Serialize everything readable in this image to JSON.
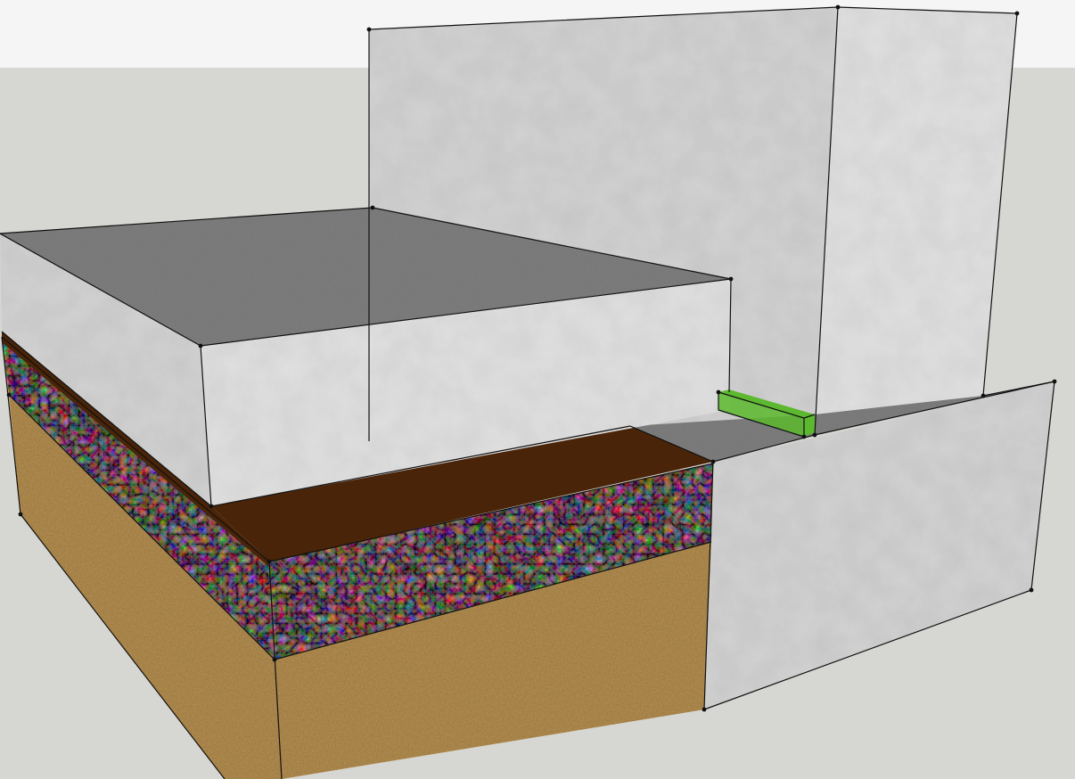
{
  "scene": {
    "background": {
      "sky": "#f4f5f4",
      "ground": "#d6d6d2"
    },
    "materials": {
      "concrete": "#d2d2d2",
      "concrete_light": "#e0e0e0",
      "concrete_top": "#7d7d7d",
      "gravel": "#8a7f78",
      "soil": "#b38f52",
      "membrane": "#4a2408",
      "insulation": "#5cb82e"
    },
    "icons": [
      "concrete-texture",
      "gravel-texture",
      "soil-texture"
    ]
  }
}
